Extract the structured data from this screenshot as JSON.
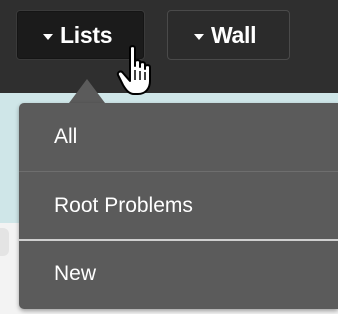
{
  "nav": {
    "lists_label": "Lists",
    "wall_label": "Wall"
  },
  "menu": {
    "items": [
      {
        "label": "All"
      },
      {
        "label": "Root Problems"
      },
      {
        "label": "New"
      }
    ]
  },
  "colors": {
    "topbar": "#2f2f2f",
    "menu_bg": "#5b5b5b",
    "content_bg": "#cfe6e8"
  },
  "icons": [
    "caret-down-icon",
    "hand-pointer-cursor-icon"
  ]
}
